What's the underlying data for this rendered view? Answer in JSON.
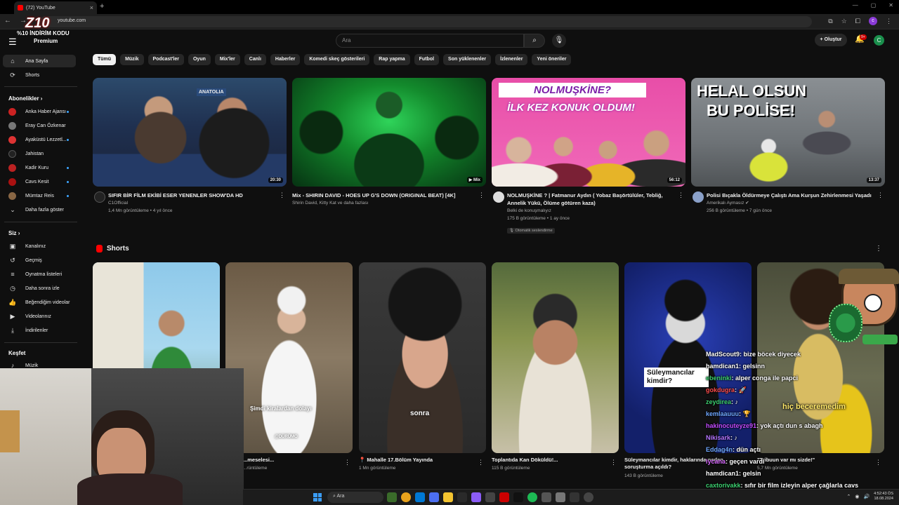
{
  "browser": {
    "tab_title": "(72) YouTube",
    "url": "youtube.com"
  },
  "overlay": {
    "promo": "%10 İNDİRİM KODU",
    "premium": "Premium"
  },
  "header": {
    "search_placeholder": "Ara",
    "create_label": "Oluştur",
    "notif_count": "9+",
    "avatar_letter": "C"
  },
  "sidebar": {
    "home": "Ana Sayfa",
    "shorts": "Shorts",
    "subs_head": "Abonelikler",
    "channels": [
      "Anka Haber Ajansı",
      "Eray Can Özkenar",
      "Ayaküstü Lezzetl...",
      "Jahistan",
      "Kadir Kuru",
      "Cavs Kesit",
      "Mümtaz Reis"
    ],
    "show_more": "Daha fazla göster",
    "you_head": "Siz",
    "you_items": [
      "Kanalınız",
      "Geçmiş",
      "Oynatma listeleri",
      "Daha sonra izle",
      "Beğendiğim videolar",
      "Videolarınız",
      "İndirilenler"
    ],
    "explore_head": "Keşfet",
    "explore_items": [
      "Müzik"
    ]
  },
  "chips": [
    "Tümü",
    "Müzik",
    "Podcast'ler",
    "Oyun",
    "Mix'ler",
    "Canlı",
    "Haberler",
    "Komedi skeç gösterileri",
    "Rap yapma",
    "Futbol",
    "Son yüklenenler",
    "İzlenenler",
    "Yeni öneriler"
  ],
  "videos": [
    {
      "title": "SIFIR BİR FİLM EKİBİ ESER YENENLER SHOW'DA HD",
      "channel": "C1Official",
      "meta": "1,4 Mn görüntüleme • 4 yıl önce",
      "duration": "20:30"
    },
    {
      "title": "Mix - SHIRIN DAVID - HOES UP G'S DOWN (ORIGINAL BEAT) [4K]",
      "channel": "Shirin David, Kitty Kat ve daha fazlası",
      "meta": "",
      "duration": "Mix"
    },
    {
      "title": "NOLMUŞKİNE ? | Fatmanur Aydın ( Yobaz Başörtülüler, Tebliğ, Annelik Yükü, Ölüme götüren kaza)",
      "channel": "Belki de konuşmalıyız",
      "meta": "175 B görüntüleme • 1 ay önce",
      "badge": "Otomatik seslendirme",
      "duration": "56:12"
    },
    {
      "title": "Polisi Bıçakla Öldürmeye Çalıştı Ama Kurşun Zehirlenmesi Yaşadı",
      "channel": "Amerikalı Aymasız",
      "meta": "256 B görüntüleme • 7 gün önce",
      "duration": "13:37"
    }
  ],
  "thumb_text": {
    "t3_top": "NOLMUŞKİNE?",
    "t3_bottom": "İLK KEZ KONUK OLDUM!",
    "t4_top": "HELAL OLSUN",
    "t4_bottom": "BU POLİSE!",
    "t1_brand": "ANATOLIA"
  },
  "shorts": {
    "title": "Shorts",
    "items": [
      {
        "title": "",
        "meta": "",
        "caption": ""
      },
      {
        "title": "...meselesi...",
        "meta": "...rüntüleme",
        "caption": "Şimdi kiralardan dolayı"
      },
      {
        "title": "📍 Mahalle 17.Bölüm Yayında",
        "meta": "1 Mn görüntüleme",
        "caption": "sonra"
      },
      {
        "title": "Toplantıda Kan Döküldü!...",
        "meta": "115 B görüntüleme",
        "caption": ""
      },
      {
        "title": "Süleymancılar kimdir, haklarında neden soruşturma açıldı?",
        "meta": "143 B görüntüleme",
        "caption": "Süleymancılar kimdir?"
      },
      {
        "title": "\"Tribuun var mı sizde!\"",
        "meta": "5,7 Mn görüntüleme",
        "caption": "hiç beceremedim"
      }
    ]
  },
  "chat": [
    {
      "user": "MadScout9",
      "text": ": bize böcek diyecek",
      "color": "#ffffff"
    },
    {
      "user": "hamdican1",
      "text": ": gelsinn",
      "color": "#ffffff"
    },
    {
      "user": "ebeninki",
      "text": ": alper conga ile papci",
      "color": "#3cd070"
    },
    {
      "user": "gokdugra",
      "text": ": 🚀",
      "color": "#ff4d4d"
    },
    {
      "user": "zeydirea",
      "text": ": ♪",
      "color": "#3cd070"
    },
    {
      "user": "kemlaauuu",
      "text": ": 🏆",
      "color": "#6fa8ff"
    },
    {
      "user": "hakinocuteyze91",
      "text": ": yok açtı dun s abagh",
      "color": "#c34bff"
    },
    {
      "user": "Nikisark",
      "text": ": ♪",
      "color": "#b675ff"
    },
    {
      "user": "Eddag4n",
      "text": ": dün açtı",
      "color": "#6fa8ff"
    },
    {
      "user": "lycana",
      "text": ": geçen vardı",
      "color": "#d96bff"
    },
    {
      "user": "hamdican1",
      "text": ": gelsin",
      "color": "#ffffff"
    },
    {
      "user": "caxtorivakk",
      "text": ": sıfır bir film izleyin alper çağlarla cavs",
      "color": "#3cd070"
    }
  ],
  "taskbar": {
    "search": "Ara",
    "time": "4:52:43 ÖS",
    "date": "18.08.2024"
  }
}
